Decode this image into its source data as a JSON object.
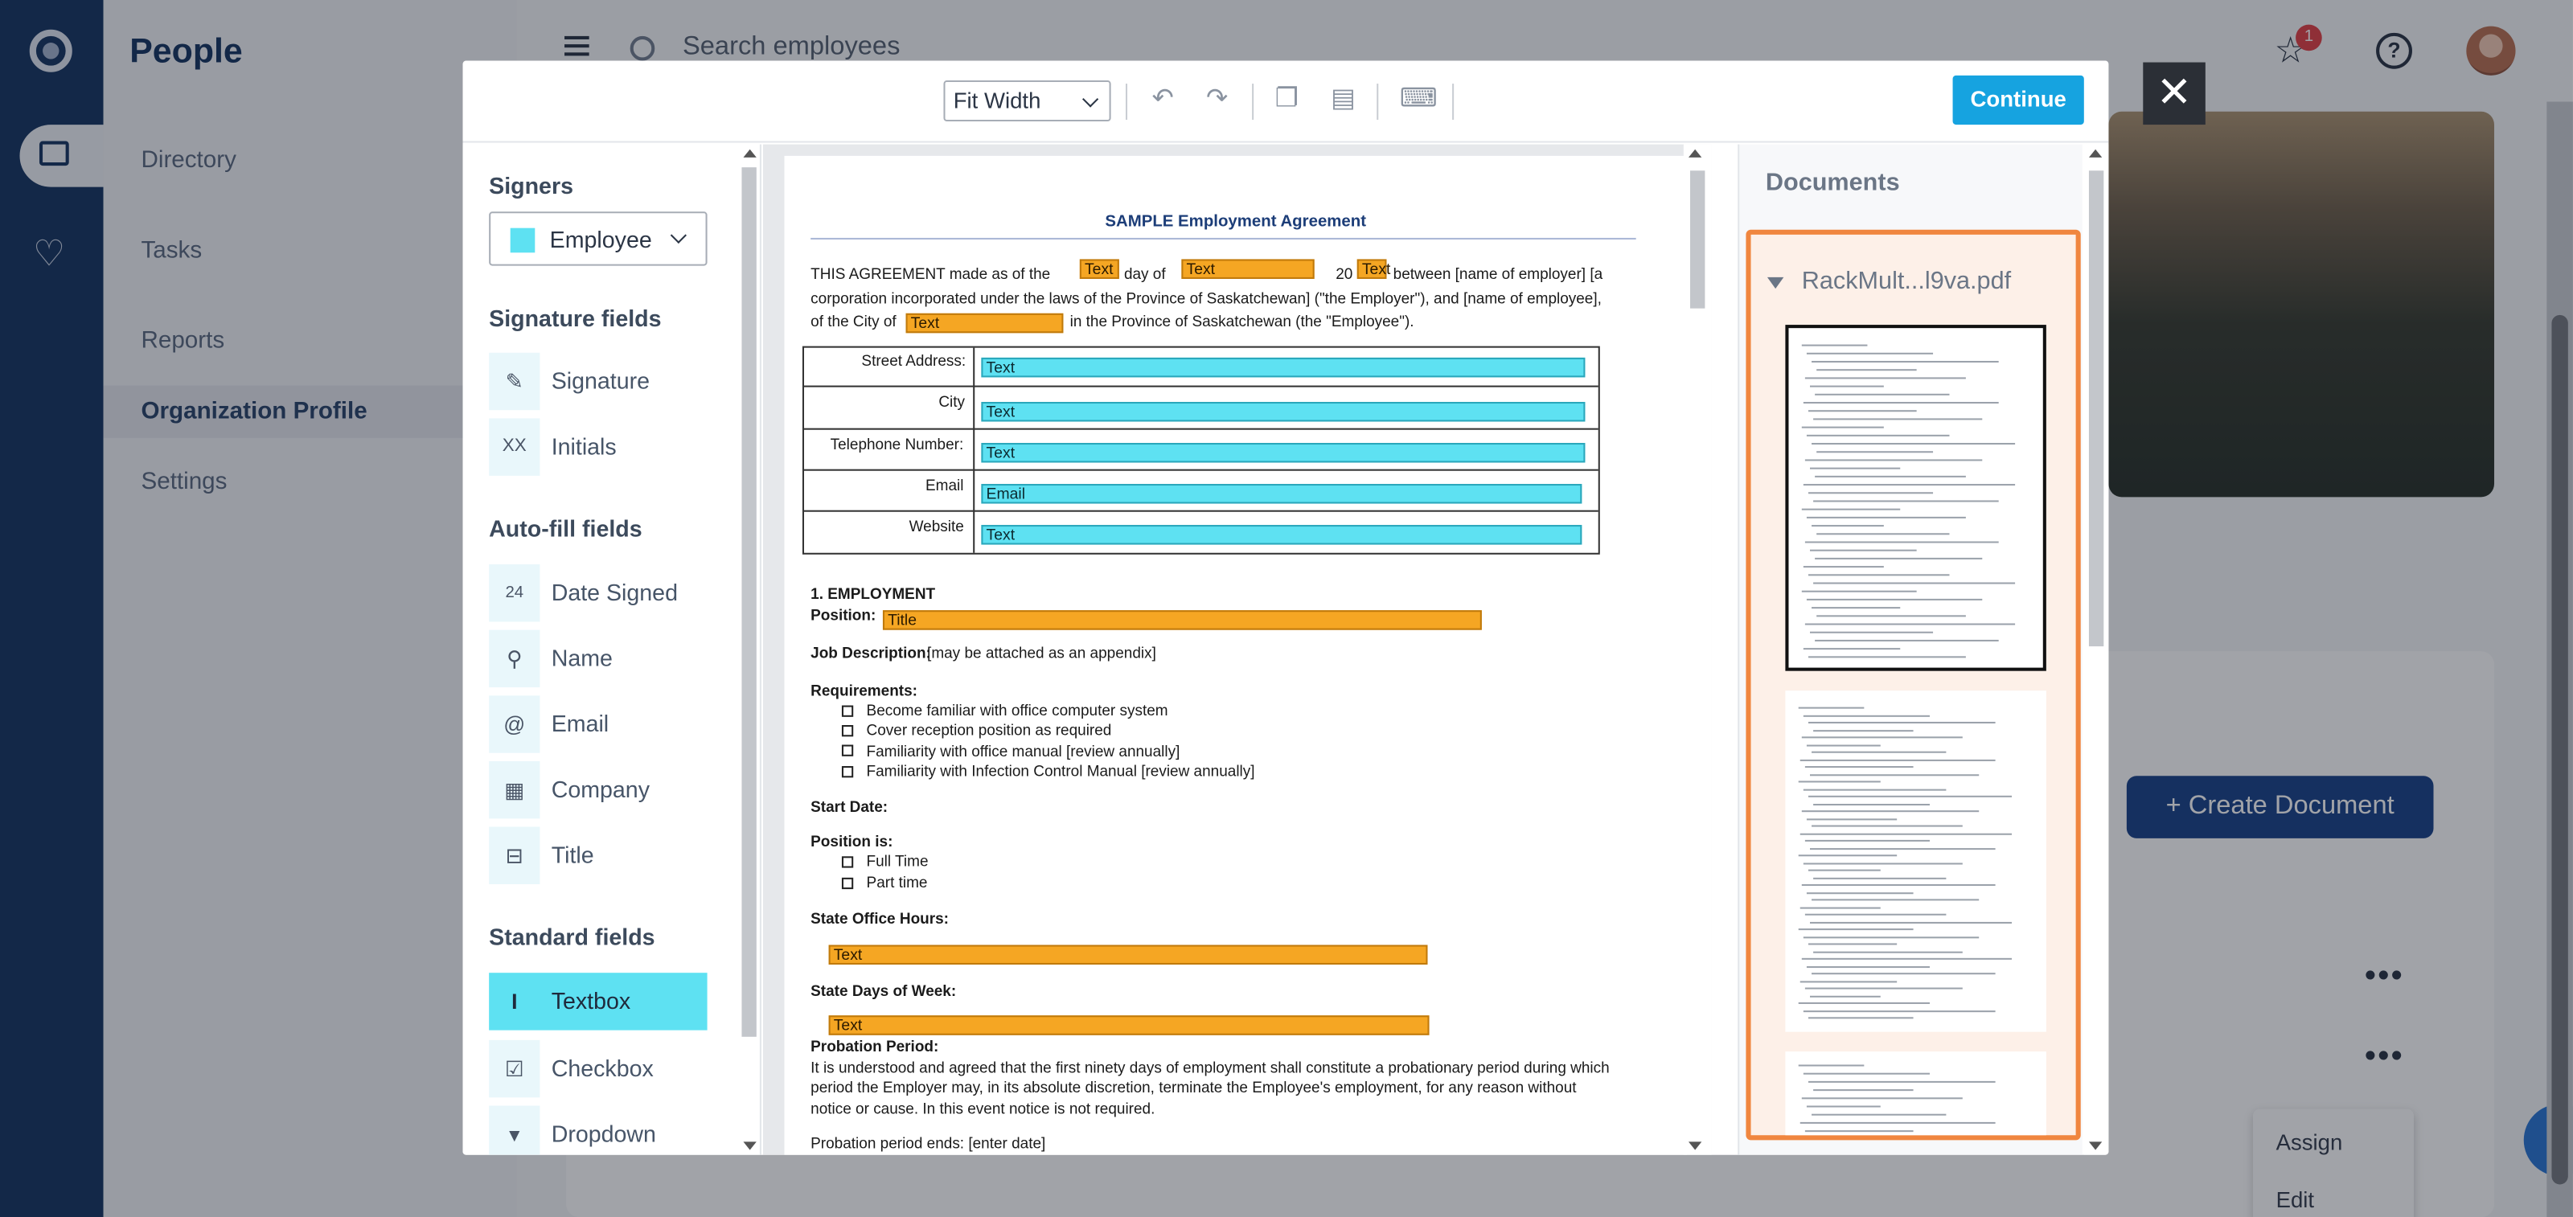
{
  "app": {
    "section_title": "People",
    "nav": [
      "Directory",
      "Tasks",
      "Reports",
      "Organization Profile",
      "Settings"
    ],
    "search_placeholder": "Search employees",
    "notification_count": "1",
    "create_button": "+ Create Document",
    "context_menu": [
      "Assign",
      "Edit"
    ]
  },
  "modal": {
    "toolbar": {
      "zoom": "Fit Width",
      "continue_label": "Continue",
      "icons": [
        "undo-icon",
        "redo-icon",
        "copy-icon",
        "paste-icon",
        "keyboard-icon"
      ]
    },
    "signers": {
      "heading": "Signers",
      "selected": "Employee",
      "swatch_color": "#5ee1f2"
    },
    "signature_fields": {
      "heading": "Signature fields",
      "items": [
        {
          "label": "Signature",
          "icon": "pen-icon"
        },
        {
          "label": "Initials",
          "icon": "initials-icon"
        }
      ]
    },
    "autofill_fields": {
      "heading": "Auto-fill fields",
      "items": [
        {
          "label": "Date Signed",
          "icon": "calendar-icon"
        },
        {
          "label": "Name",
          "icon": "person-icon"
        },
        {
          "label": "Email",
          "icon": "at-icon"
        },
        {
          "label": "Company",
          "icon": "building-icon"
        },
        {
          "label": "Title",
          "icon": "briefcase-icon"
        }
      ]
    },
    "standard_fields": {
      "heading": "Standard fields",
      "items": [
        {
          "label": "Textbox",
          "icon": "textbox-icon",
          "active": true
        },
        {
          "label": "Checkbox",
          "icon": "checkbox-icon"
        },
        {
          "label": "Dropdown",
          "icon": "dropdown-icon"
        }
      ]
    },
    "document": {
      "title": "SAMPLE Employment Agreement",
      "intro_1": "THIS AGREEMENT made as of the",
      "intro_day": "day of",
      "intro_20": "20",
      "intro_between": "between [name of employer] [a",
      "intro_2": "corporation incorporated under the laws of the Province of Saskatchewan] (\"the Employer\"), and [name of employee],",
      "intro_3a": "of the City of",
      "intro_3b": "in the Province of Saskatchewan (the \"Employee\").",
      "address_rows": [
        {
          "label": "Street Address:",
          "field": "Text"
        },
        {
          "label": "City",
          "field": "Text"
        },
        {
          "label": "Telephone Number:",
          "field": "Text"
        },
        {
          "label": "Email",
          "field": "Email"
        },
        {
          "label": "Website",
          "field": "Text"
        }
      ],
      "field_text": "Text",
      "section_1": "1.   EMPLOYMENT",
      "position_label": "Position:",
      "position_field": "Title",
      "job_desc_label": "Job Description:",
      "job_desc_value": "[may be attached as an appendix]",
      "requirements_label": "Requirements:",
      "requirements": [
        "Become familiar with office computer system",
        "Cover reception position as required",
        "Familiarity with office manual [review annually]",
        "Familiarity with Infection Control Manual [review annually]"
      ],
      "start_date_label": "Start Date:",
      "position_is_label": "Position is:",
      "position_options": [
        "Full Time",
        "Part time"
      ],
      "office_hours_label": "State Office Hours:",
      "days_label": "State Days of Week:",
      "probation_label": "Probation Period:",
      "probation_lines": [
        "It is understood and agreed that the first ninety days of employment shall constitute a probationary period during which",
        "period the Employer may, in its absolute discretion, terminate the Employee's employment, for any reason without",
        "notice or cause.  In this event notice is not required."
      ],
      "probation_end": "Probation period ends: [enter date]"
    },
    "documents_panel": {
      "heading": "Documents",
      "file_name": "RackMult...l9va.pdf"
    }
  }
}
